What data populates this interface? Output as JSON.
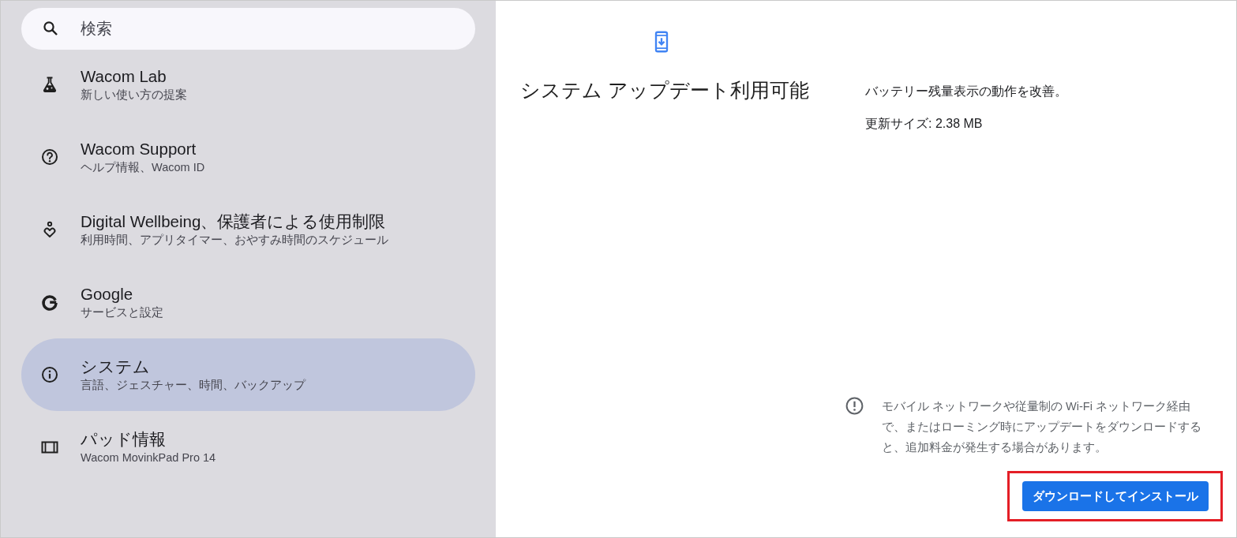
{
  "search": {
    "placeholder": "検索"
  },
  "sidebar": {
    "items": [
      {
        "title": "Wacom Lab",
        "subtitle": "新しい使い方の提案",
        "selected": false
      },
      {
        "title": "Wacom Support",
        "subtitle": "ヘルプ情報、Wacom ID",
        "selected": false
      },
      {
        "title": "Digital Wellbeing、保護者による使用制限",
        "subtitle": "利用時間、アプリタイマー、おやすみ時間のスケジュール",
        "selected": false
      },
      {
        "title": "Google",
        "subtitle": "サービスと設定",
        "selected": false
      },
      {
        "title": "システム",
        "subtitle": "言語、ジェスチャー、時間、バックアップ",
        "selected": true
      },
      {
        "title": "パッド情報",
        "subtitle": "Wacom MovinkPad Pro 14",
        "selected": false
      }
    ]
  },
  "update": {
    "title": "システム アップデート利用可能",
    "description": "バッテリー残量表示の動作を改善。",
    "size": "更新サイズ: 2.38 MB",
    "note": "モバイル ネットワークや従量制の Wi-Fi ネットワーク経由で、またはローミング時にアップデートをダウンロードすると、追加料金が発生する場合があります。",
    "button": {
      "label": "ダウンロードしてインストール",
      "highlighted": true
    }
  }
}
